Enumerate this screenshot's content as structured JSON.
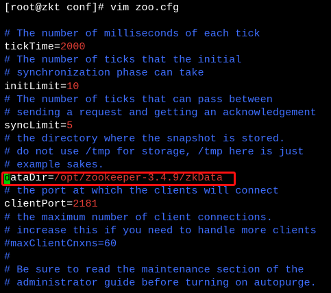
{
  "prompt": {
    "text": "[root@zkt conf]# vim zoo.cfg"
  },
  "colors": {
    "background": "#000000",
    "comment": "#3f6fff",
    "value": "#e23e36",
    "cursor": "#00cc00",
    "highlight_box": "#ff1010"
  },
  "lines": {
    "c1": "# The number of milliseconds of each tick",
    "tick_key": "tickTime=",
    "tick_val": "2000",
    "c2": "# The number of ticks that the initial",
    "c3": "# synchronization phase can take",
    "init_key": "initLimit=",
    "init_val": "10",
    "c4": "# The number of ticks that can pass between",
    "c5": "# sending a request and getting an acknowledgement",
    "sync_key": "syncLimit=",
    "sync_val": "5",
    "c6": "# the directory where the snapshot is stored.",
    "c7": "# do not use /tmp for storage, /tmp here is just",
    "c8": "# example sakes.",
    "data_cursor": "d",
    "data_key": "ataDir=",
    "data_val": "/opt/zookeeper-3.4.9/zkData",
    "c9": "# the port at which the clients will connect",
    "port_key": "clientPort=",
    "port_val": "2181",
    "c10": "# the maximum number of client connections.",
    "c11": "# increase this if you need to handle more clients",
    "c12": "#maxClientCnxns=60",
    "c13": "#",
    "c14": "# Be sure to read the maintenance section of the",
    "c15": "# administrator guide before turning on autopurge."
  }
}
